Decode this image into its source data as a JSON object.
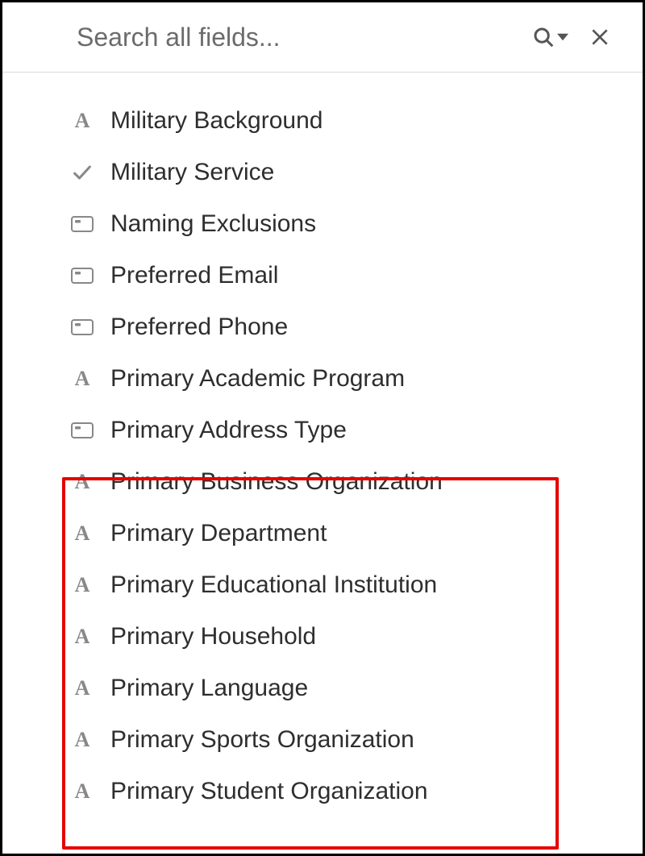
{
  "search": {
    "placeholder": "Search all fields..."
  },
  "fields": [
    {
      "icon": "text",
      "label": "Military Background"
    },
    {
      "icon": "check",
      "label": "Military Service"
    },
    {
      "icon": "boxed",
      "label": "Naming Exclusions"
    },
    {
      "icon": "boxed",
      "label": "Preferred Email"
    },
    {
      "icon": "boxed",
      "label": "Preferred Phone"
    },
    {
      "icon": "text",
      "label": "Primary Academic Program"
    },
    {
      "icon": "boxed",
      "label": "Primary Address Type"
    },
    {
      "icon": "text",
      "label": "Primary Business Organization"
    },
    {
      "icon": "text",
      "label": "Primary Department"
    },
    {
      "icon": "text",
      "label": "Primary Educational Institution"
    },
    {
      "icon": "text",
      "label": "Primary Household"
    },
    {
      "icon": "text",
      "label": "Primary Language"
    },
    {
      "icon": "text",
      "label": "Primary Sports Organization"
    },
    {
      "icon": "text",
      "label": "Primary Student Organization"
    }
  ]
}
